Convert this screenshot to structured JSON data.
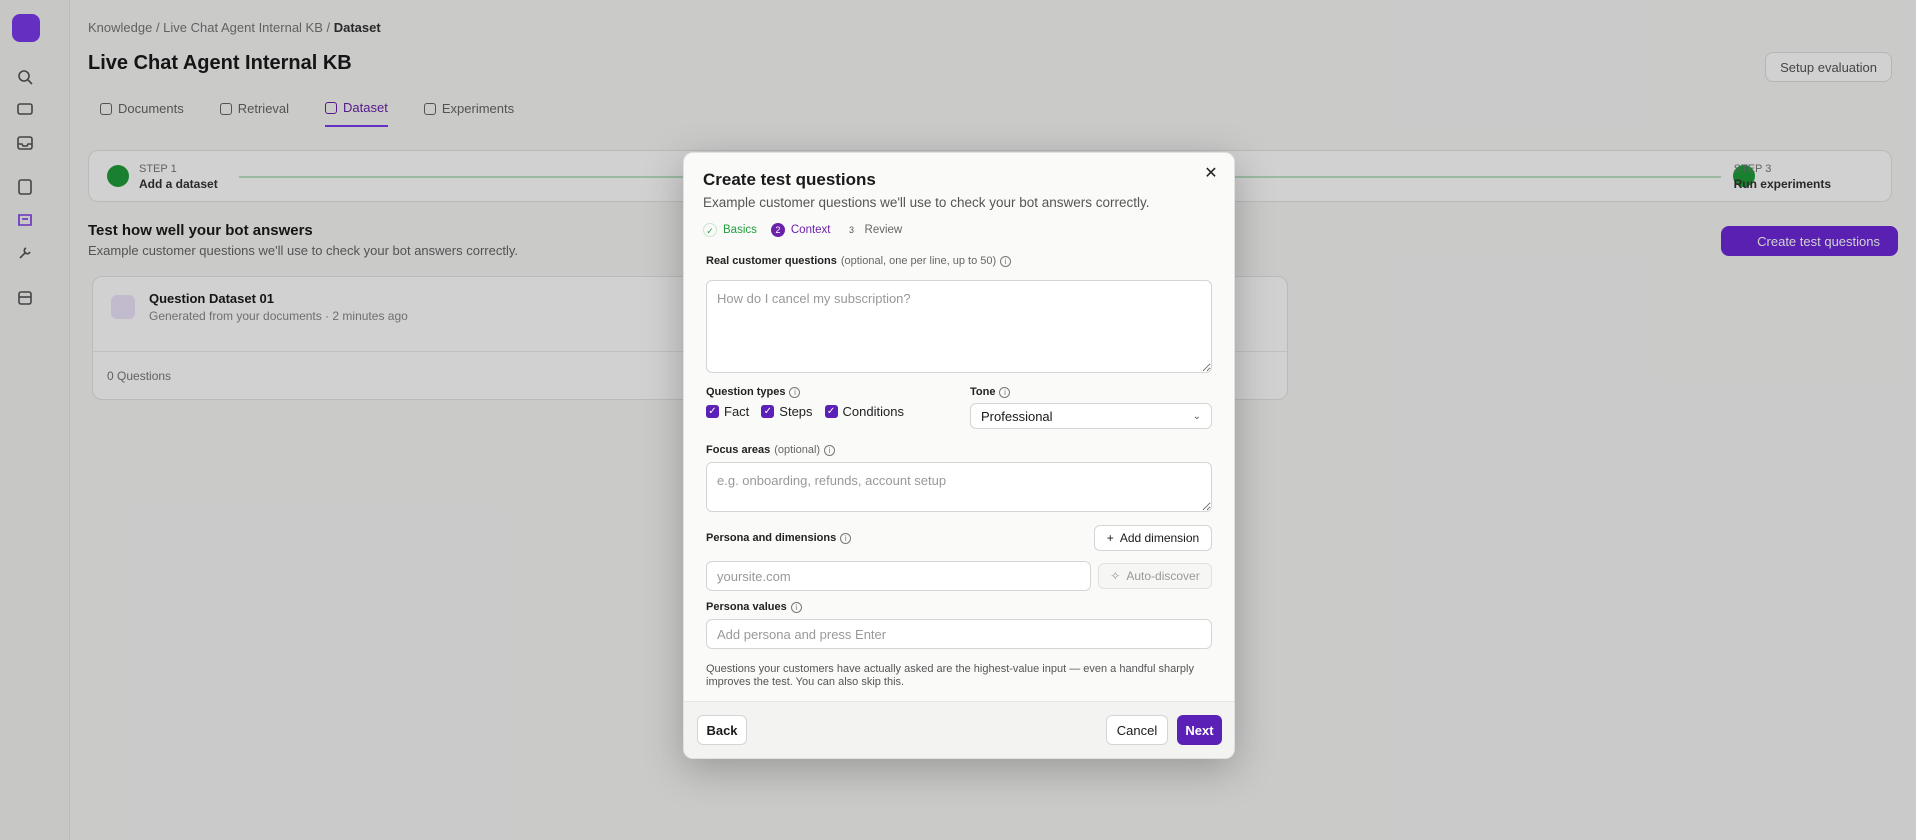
{
  "background": {
    "breadcrumbs": [
      "Knowledge",
      "Live Chat Agent Internal KB",
      "Dataset"
    ],
    "page_title": "Live Chat Agent Internal KB",
    "setup_button": "Setup evaluation",
    "tabs": [
      "Documents",
      "Retrieval",
      "Dataset",
      "Experiments"
    ],
    "steps": {
      "left_step": "STEP 1",
      "left_label": "Add a dataset",
      "right_step": "STEP 3",
      "right_label": "Run experiments"
    },
    "section_title": "Test how well your bot answers",
    "section_subtitle": "Example customer questions we'll use to check your bot answers correctly.",
    "create_button": "Create test questions",
    "dataset_card": {
      "name": "Question Dataset 01",
      "meta": "Generated from your documents · 2 minutes ago",
      "question_count": "0 Questions"
    }
  },
  "modal": {
    "title": "Create test questions",
    "subtitle": "Example customer questions we'll use to check your bot answers correctly.",
    "stepper": [
      {
        "num": "✓",
        "label": "Basics",
        "state": "done"
      },
      {
        "num": "2",
        "label": "Context",
        "state": "current"
      },
      {
        "num": "3",
        "label": "Review",
        "state": "todo"
      }
    ],
    "real_questions": {
      "label": "Real customer questions",
      "optional": "(optional, one per line, up to 50)",
      "placeholder": "How do I cancel my subscription?"
    },
    "question_types": {
      "label": "Question types",
      "options": [
        {
          "label": "Fact",
          "checked": true
        },
        {
          "label": "Steps",
          "checked": true
        },
        {
          "label": "Conditions",
          "checked": true
        }
      ]
    },
    "tone": {
      "label": "Tone",
      "value": "Professional"
    },
    "focus_areas": {
      "label": "Focus areas",
      "optional": "(optional)",
      "placeholder": "e.g. onboarding, refunds, account setup"
    },
    "persona_dimensions": {
      "label": "Persona and dimensions",
      "add_button": "Add dimension",
      "url_placeholder": "yoursite.com",
      "auto_discover": "Auto-discover"
    },
    "persona_values": {
      "label": "Persona values",
      "placeholder": "Add persona and press Enter"
    },
    "hint": "Questions your customers have actually asked are the highest-value input — even a handful sharply improves the test. You can also skip this.",
    "footer": {
      "back": "Back",
      "cancel": "Cancel",
      "next": "Next"
    }
  },
  "colors": {
    "accent": "#5b21b6",
    "success": "#1f9d3a"
  }
}
